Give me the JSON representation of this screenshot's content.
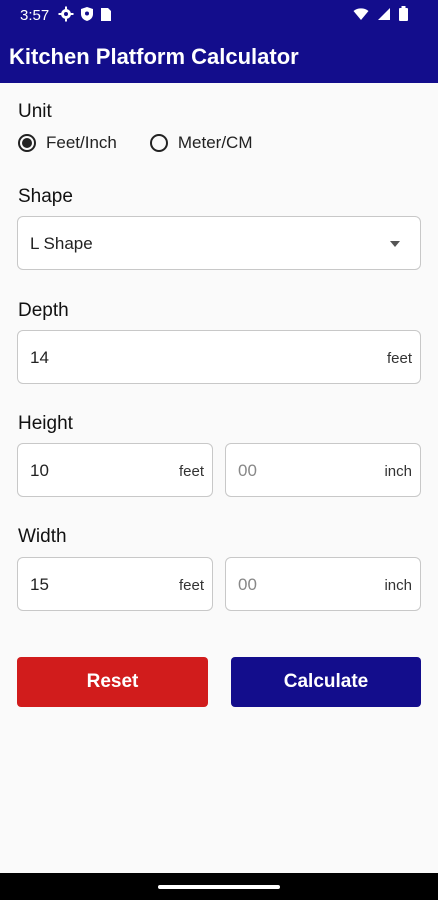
{
  "status_bar": {
    "time": "3:57",
    "icons_left": [
      "gear-icon",
      "shield-icon",
      "sim-card-icon"
    ],
    "icons_right": [
      "wifi-icon",
      "signal-icon",
      "battery-icon"
    ]
  },
  "app": {
    "title": "Kitchen Platform Calculator"
  },
  "unit": {
    "label": "Unit",
    "options": [
      {
        "label": "Feet/Inch",
        "selected": true
      },
      {
        "label": "Meter/CM",
        "selected": false
      }
    ]
  },
  "shape": {
    "label": "Shape",
    "selected": "L Shape"
  },
  "depth": {
    "label": "Depth",
    "value": "14",
    "suffix": "feet"
  },
  "height": {
    "label": "Height",
    "feet_value": "10",
    "feet_suffix": "feet",
    "inch_placeholder": "00",
    "inch_suffix": "inch"
  },
  "width": {
    "label": "Width",
    "feet_value": "15",
    "feet_suffix": "feet",
    "inch_placeholder": "00",
    "inch_suffix": "inch"
  },
  "buttons": {
    "reset_label": "Reset",
    "calculate_label": "Calculate"
  },
  "colors": {
    "primary": "#130d8c",
    "reset": "#d11c1c",
    "background": "#fafafa"
  }
}
